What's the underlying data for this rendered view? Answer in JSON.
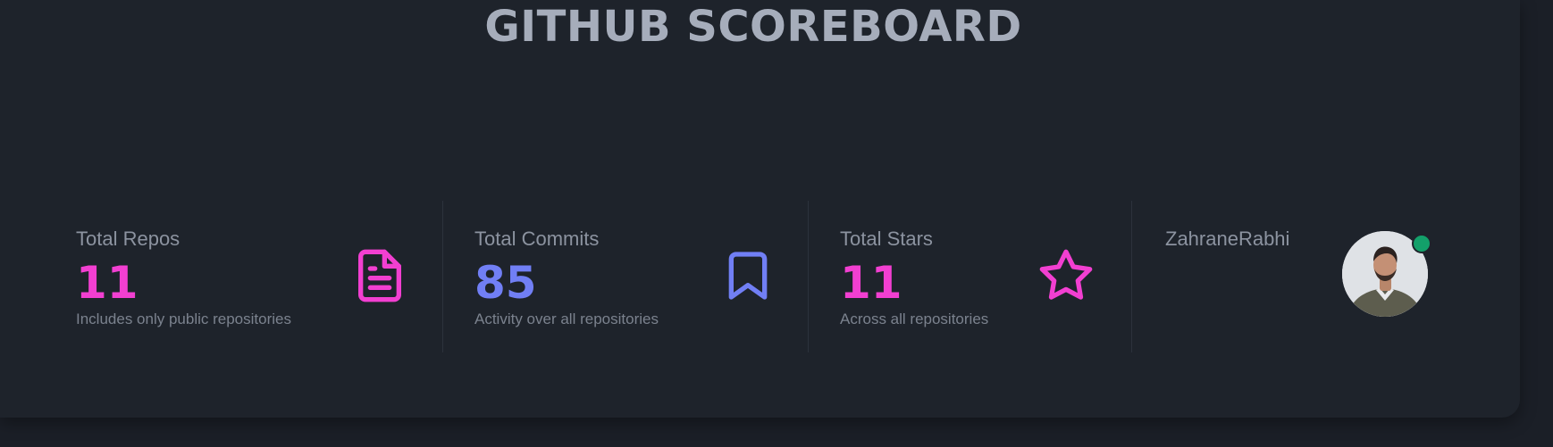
{
  "header": {
    "title": "GITHUB SCOREBOARD"
  },
  "stats": [
    {
      "title": "Total Repos",
      "value": "11",
      "description": "Includes only public repositories",
      "icon": "document-icon",
      "color": "#f23fd1"
    },
    {
      "title": "Total Commits",
      "value": "85",
      "description": "Activity over all repositories",
      "icon": "bookmark-icon",
      "color": "#717ff5"
    },
    {
      "title": "Total Stars",
      "value": "11",
      "description": "Across all repositories",
      "icon": "star-icon",
      "color": "#f23fd1"
    }
  ],
  "profile": {
    "username": "ZahraneRabhi",
    "status": "online",
    "status_color": "#13a06a"
  },
  "colors": {
    "background": "#1b1f27",
    "card": "#1e232b",
    "title": "#a6adbb"
  }
}
